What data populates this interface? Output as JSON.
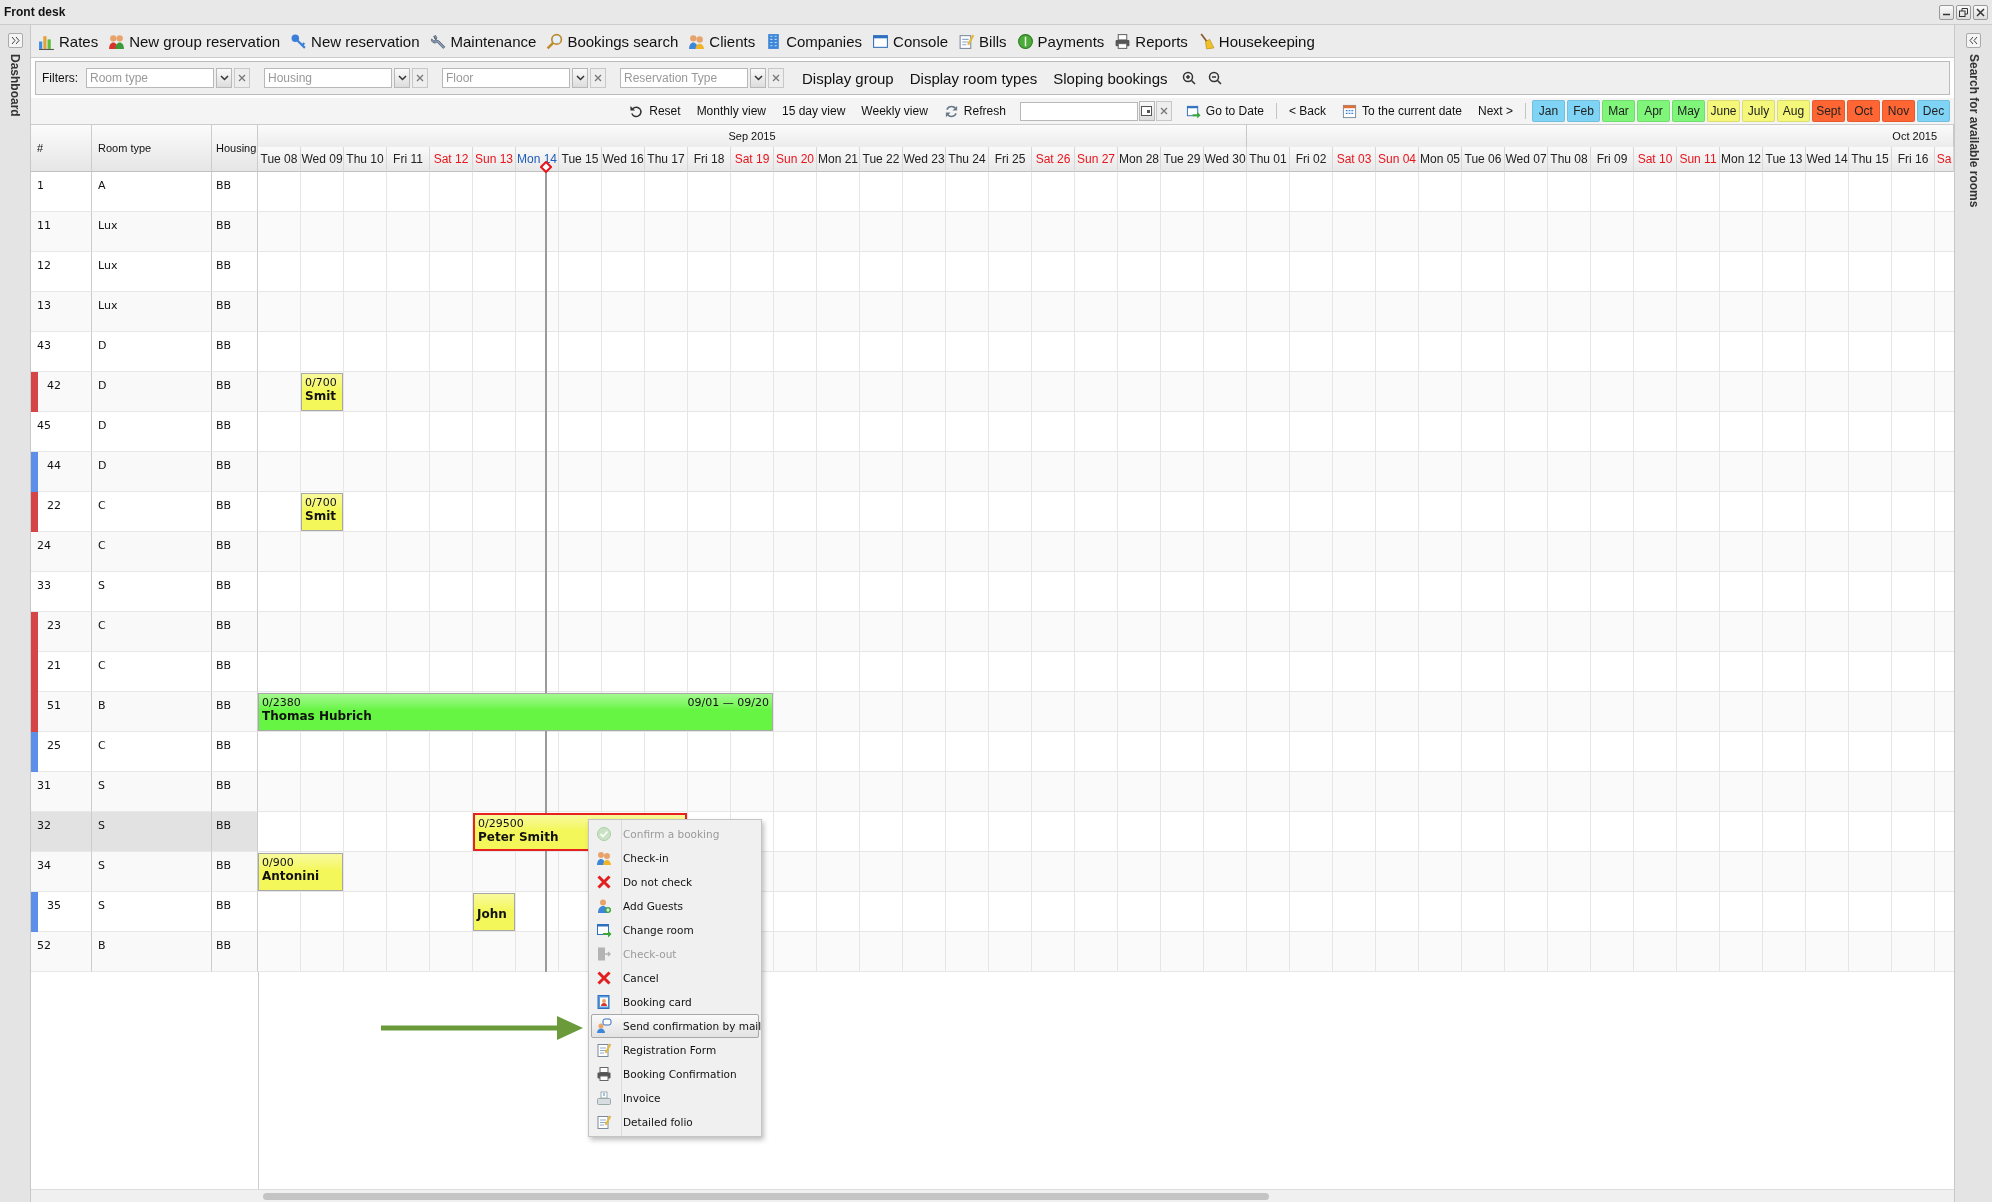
{
  "window": {
    "title": "Front desk"
  },
  "left_panel": {
    "title": "Dashboard"
  },
  "right_panel": {
    "title": "Search for available rooms"
  },
  "toolbar": [
    {
      "label": "Rates",
      "kind": "chart"
    },
    {
      "label": "New group reservation",
      "kind": "group"
    },
    {
      "label": "New reservation",
      "kind": "key"
    },
    {
      "label": "Maintenance",
      "kind": "wrench"
    },
    {
      "label": "Bookings search",
      "kind": "search"
    },
    {
      "label": "Clients",
      "kind": "people"
    },
    {
      "label": "Companies",
      "kind": "building"
    },
    {
      "label": "Console",
      "kind": "window"
    },
    {
      "label": "Bills",
      "kind": "notepad"
    },
    {
      "label": "Payments",
      "kind": "coin"
    },
    {
      "label": "Reports",
      "kind": "printer"
    },
    {
      "label": "Housekeeping",
      "kind": "broom"
    }
  ],
  "filters": {
    "label": "Filters:",
    "fields": [
      {
        "placeholder": "Room type"
      },
      {
        "placeholder": "Housing"
      },
      {
        "placeholder": "Floor"
      },
      {
        "placeholder": "Reservation Type"
      }
    ],
    "buttons": [
      "Display group",
      "Display room types",
      "Sloping bookings"
    ]
  },
  "nav": {
    "reset": "Reset",
    "views": [
      "Monthly view",
      "15 day view",
      "Weekly view"
    ],
    "refresh": "Refresh",
    "go_to_date": "Go to Date",
    "back": "< Back",
    "current": "To the current date",
    "next": "Next >",
    "months": [
      {
        "label": "Jan",
        "color": "#7fd4f5"
      },
      {
        "label": "Feb",
        "color": "#7fd4f5"
      },
      {
        "label": "Mar",
        "color": "#7ff57a"
      },
      {
        "label": "Apr",
        "color": "#7ff57a"
      },
      {
        "label": "May",
        "color": "#7ff57a"
      },
      {
        "label": "June",
        "color": "#f4f77a"
      },
      {
        "label": "July",
        "color": "#f4f77a"
      },
      {
        "label": "Aug",
        "color": "#f4f77a"
      },
      {
        "label": "Sept",
        "color": "#ff6633"
      },
      {
        "label": "Oct",
        "color": "#ff6633"
      },
      {
        "label": "Nov",
        "color": "#ff6633"
      },
      {
        "label": "Dec",
        "color": "#7fd4f5"
      }
    ]
  },
  "grid": {
    "columns": [
      "#",
      "Room type",
      "Housing"
    ],
    "months": [
      {
        "label": "Sep 2015",
        "days": [
          {
            "label": "Tue 08",
            "kind": "weekday"
          },
          {
            "label": "Wed 09",
            "kind": "weekday"
          },
          {
            "label": "Thu 10",
            "kind": "weekday"
          },
          {
            "label": "Fri 11",
            "kind": "weekday"
          },
          {
            "label": "Sat 12",
            "kind": "weekend"
          },
          {
            "label": "Sun 13",
            "kind": "weekend"
          },
          {
            "label": "Mon 14",
            "kind": "today"
          },
          {
            "label": "Tue 15",
            "kind": "weekday"
          },
          {
            "label": "Wed 16",
            "kind": "weekday"
          },
          {
            "label": "Thu 17",
            "kind": "weekday"
          },
          {
            "label": "Fri 18",
            "kind": "weekday"
          },
          {
            "label": "Sat 19",
            "kind": "weekend"
          },
          {
            "label": "Sun 20",
            "kind": "weekend"
          },
          {
            "label": "Mon 21",
            "kind": "weekday"
          },
          {
            "label": "Tue 22",
            "kind": "weekday"
          },
          {
            "label": "Wed 23",
            "kind": "weekday"
          },
          {
            "label": "Thu 24",
            "kind": "weekday"
          },
          {
            "label": "Fri 25",
            "kind": "weekday"
          },
          {
            "label": "Sat 26",
            "kind": "weekend"
          },
          {
            "label": "Sun 27",
            "kind": "weekend"
          },
          {
            "label": "Mon 28",
            "kind": "weekday"
          },
          {
            "label": "Tue 29",
            "kind": "weekday"
          },
          {
            "label": "Wed 30",
            "kind": "weekday"
          }
        ]
      },
      {
        "label": "Oct 2015",
        "days": [
          {
            "label": "Thu 01",
            "kind": "weekday"
          },
          {
            "label": "Fri 02",
            "kind": "weekday"
          },
          {
            "label": "Sat 03",
            "kind": "weekend"
          },
          {
            "label": "Sun 04",
            "kind": "weekend"
          },
          {
            "label": "Mon 05",
            "kind": "weekday"
          },
          {
            "label": "Tue 06",
            "kind": "weekday"
          },
          {
            "label": "Wed 07",
            "kind": "weekday"
          },
          {
            "label": "Thu 08",
            "kind": "weekday"
          },
          {
            "label": "Fri 09",
            "kind": "weekday"
          },
          {
            "label": "Sat 10",
            "kind": "weekend"
          },
          {
            "label": "Sun 11",
            "kind": "weekend"
          },
          {
            "label": "Mon 12",
            "kind": "weekday"
          },
          {
            "label": "Tue 13",
            "kind": "weekday"
          },
          {
            "label": "Wed 14",
            "kind": "weekday"
          },
          {
            "label": "Thu 15",
            "kind": "weekday"
          },
          {
            "label": "Fri 16",
            "kind": "weekday"
          },
          {
            "label": "Sa",
            "kind": "weekend"
          }
        ]
      }
    ],
    "rows": [
      {
        "number": "1",
        "room_type": "A",
        "housing": "BB",
        "selected": false
      },
      {
        "number": "11",
        "room_type": "Lux",
        "housing": "BB",
        "selected": false
      },
      {
        "number": "12",
        "room_type": "Lux",
        "housing": "BB",
        "selected": false
      },
      {
        "number": "13",
        "room_type": "Lux",
        "housing": "BB",
        "selected": false
      },
      {
        "number": "43",
        "room_type": "D",
        "housing": "BB",
        "selected": false
      },
      {
        "number": "42",
        "room_type": "D",
        "housing": "BB",
        "selected": false,
        "color": "#d64545",
        "slots": [
          {
            "kind": "free"
          },
          {
            "kind": "booking",
            "amount": "0/700",
            "guest": "Smit",
            "color": "#f4f75a",
            "selected": false
          }
        ]
      },
      {
        "number": "45",
        "room_type": "D",
        "housing": "BB",
        "selected": false
      },
      {
        "number": "44",
        "room_type": "D",
        "housing": "BB",
        "selected": false,
        "color": "#5b8fe8"
      },
      {
        "number": "22",
        "room_type": "C",
        "housing": "BB",
        "selected": false,
        "color": "#d64545",
        "slots": [
          {
            "kind": "free"
          },
          {
            "kind": "booking",
            "amount": "0/700",
            "guest": "Smit",
            "color": "#f4f75a",
            "selected": false
          }
        ]
      },
      {
        "number": "24",
        "room_type": "C",
        "housing": "BB",
        "selected": false
      },
      {
        "number": "33",
        "room_type": "S",
        "housing": "BB",
        "selected": false
      },
      {
        "number": "23",
        "room_type": "C",
        "housing": "BB",
        "selected": false,
        "color": "#d64545"
      },
      {
        "number": "21",
        "room_type": "C",
        "housing": "BB",
        "selected": false,
        "color": "#d64545"
      },
      {
        "number": "51",
        "room_type": "B",
        "housing": "BB",
        "selected": false,
        "color": "#d64545",
        "slots": [
          {
            "kind": "booking",
            "amount": "0/2380",
            "guest": "Thomas Hubrich",
            "dates": "09/01 — 09/20",
            "color": "#66f542",
            "selected": false
          },
          {
            "kind": "continued"
          },
          {
            "kind": "continued"
          },
          {
            "kind": "continued"
          },
          {
            "kind": "continued"
          },
          {
            "kind": "continued"
          },
          {
            "kind": "continued"
          },
          {
            "kind": "continued"
          },
          {
            "kind": "continued"
          },
          {
            "kind": "continued"
          },
          {
            "kind": "continued"
          },
          {
            "kind": "continued"
          }
        ]
      },
      {
        "number": "25",
        "room_type": "C",
        "housing": "BB",
        "selected": false,
        "color": "#5b8fe8"
      },
      {
        "number": "31",
        "room_type": "S",
        "housing": "BB",
        "selected": false
      },
      {
        "number": "32",
        "room_type": "S",
        "housing": "BB",
        "selected": true,
        "slots": [
          {
            "kind": "free"
          },
          {
            "kind": "free"
          },
          {
            "kind": "free"
          },
          {
            "kind": "free"
          },
          {
            "kind": "free"
          },
          {
            "kind": "booking",
            "amount": "0/29500",
            "guest": "Peter Smith",
            "color": "#f4f75a",
            "selected": true
          },
          {
            "kind": "continued"
          },
          {
            "kind": "continued"
          },
          {
            "kind": "continued"
          },
          {
            "kind": "continued"
          }
        ]
      },
      {
        "number": "34",
        "room_type": "S",
        "housing": "BB",
        "selected": false,
        "slots": [
          {
            "kind": "booking",
            "amount": "0/900",
            "guest": "Antonini",
            "color": "#f4f75a",
            "selected": false
          },
          {
            "kind": "continued"
          }
        ]
      },
      {
        "number": "35",
        "room_type": "S",
        "housing": "BB",
        "selected": false,
        "color": "#5b8fe8",
        "slots": [
          {
            "kind": "free"
          },
          {
            "kind": "free"
          },
          {
            "kind": "free"
          },
          {
            "kind": "free"
          },
          {
            "kind": "free"
          },
          {
            "kind": "booking",
            "guest": "John",
            "color": "#f4f75a",
            "selected": false
          }
        ]
      },
      {
        "number": "52",
        "room_type": "B",
        "housing": "BB",
        "selected": false
      }
    ]
  },
  "context_menu": [
    {
      "label": "Confirm a booking",
      "kind": "check",
      "disabled": true,
      "selected": false
    },
    {
      "label": "Check-in",
      "kind": "people",
      "disabled": false,
      "selected": false
    },
    {
      "label": "Do not check",
      "kind": "cross",
      "disabled": false,
      "selected": false
    },
    {
      "label": "Add Guests",
      "kind": "person-add",
      "disabled": false,
      "selected": false
    },
    {
      "label": "Change room",
      "kind": "window-arrow",
      "disabled": false,
      "selected": false
    },
    {
      "label": "Check-out",
      "kind": "door",
      "disabled": true,
      "selected": false
    },
    {
      "label": "Cancel",
      "kind": "cross",
      "disabled": false,
      "selected": false
    },
    {
      "label": "Booking card",
      "kind": "card",
      "disabled": false,
      "selected": false
    },
    {
      "label": "Send confirmation by mail",
      "kind": "person-chat",
      "disabled": false,
      "selected": true
    },
    {
      "label": "Registration Form",
      "kind": "notepad",
      "disabled": false,
      "selected": false
    },
    {
      "label": "Booking Confirmation",
      "kind": "printer",
      "disabled": false,
      "selected": false
    },
    {
      "label": "Invoice",
      "kind": "tray",
      "disabled": false,
      "selected": false
    },
    {
      "label": "Detailed folio",
      "kind": "notepad",
      "disabled": false,
      "selected": false
    }
  ]
}
